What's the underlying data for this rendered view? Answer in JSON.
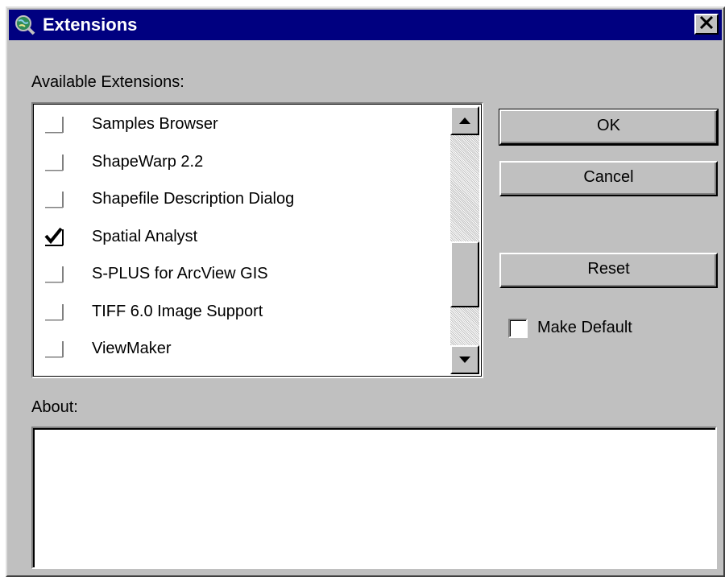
{
  "window": {
    "title": "Extensions",
    "icon": "globe-magnifier-icon",
    "close_icon": "close-x-icon"
  },
  "available": {
    "label": "Available Extensions:",
    "items": [
      {
        "label": "Samples Browser",
        "checked": false
      },
      {
        "label": "ShapeWarp 2.2",
        "checked": false
      },
      {
        "label": "Shapefile Description Dialog",
        "checked": false
      },
      {
        "label": "Spatial Analyst",
        "checked": true
      },
      {
        "label": "S-PLUS for ArcView GIS",
        "checked": false
      },
      {
        "label": "TIFF 6.0 Image Support",
        "checked": false
      },
      {
        "label": "ViewMaker",
        "checked": false
      }
    ]
  },
  "buttons": {
    "ok": "OK",
    "cancel": "Cancel",
    "reset": "Reset"
  },
  "make_default": {
    "label": "Make Default",
    "checked": false
  },
  "about": {
    "label": "About:",
    "text": ""
  },
  "colors": {
    "titlebar": "#000080",
    "face": "#c0c0c0"
  }
}
